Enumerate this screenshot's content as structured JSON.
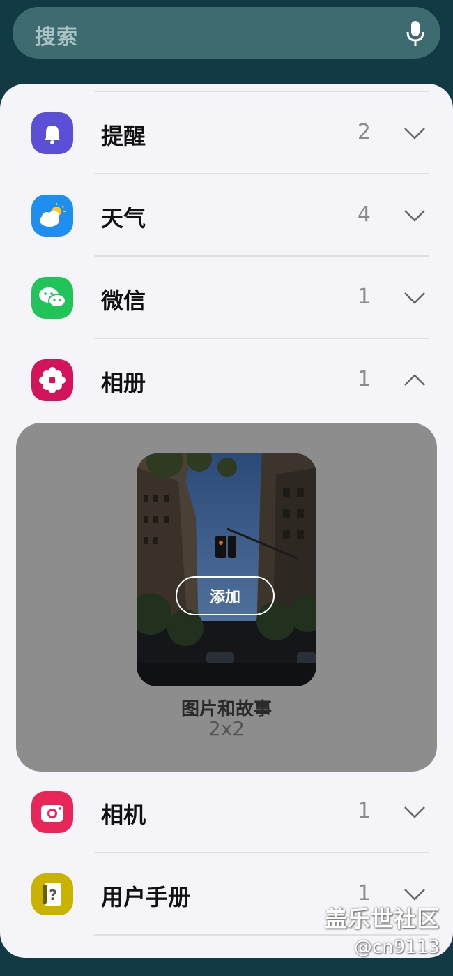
{
  "search": {
    "placeholder": "搜索"
  },
  "apps": [
    {
      "label": "提醒",
      "count": "2",
      "expanded": false
    },
    {
      "label": "天气",
      "count": "4",
      "expanded": false
    },
    {
      "label": "微信",
      "count": "1",
      "expanded": false
    },
    {
      "label": "相册",
      "count": "1",
      "expanded": true
    },
    {
      "label": "相机",
      "count": "1",
      "expanded": false
    },
    {
      "label": "用户手册",
      "count": "1",
      "expanded": false
    }
  ],
  "widget": {
    "add_label": "添加",
    "name": "图片和故事",
    "size": "2x2"
  },
  "watermark": {
    "line1": "盖乐世社区",
    "line2": "@cn9113"
  },
  "colors": {
    "reminder": "#5a4fd6",
    "weather": "#1e8ff0",
    "wechat": "#22c35b",
    "gallery": "#d4145a",
    "camera": "#e8265a",
    "manual": "#c9b200"
  }
}
